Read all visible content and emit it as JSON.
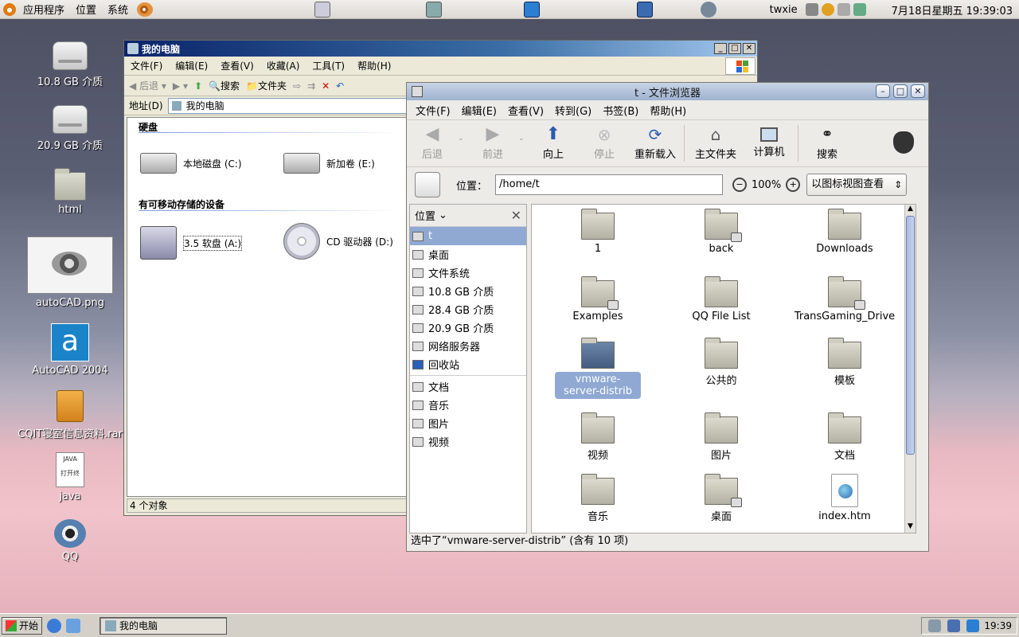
{
  "topbar": {
    "menu": [
      "应用程序",
      "位置",
      "系统"
    ],
    "user": "twxie",
    "datetime": "7月18日星期五 19:39:03"
  },
  "desktop_icons": [
    {
      "label": "10.8 GB 介质",
      "icon": "drive-icon"
    },
    {
      "label": "20.9 GB 介质",
      "icon": "drive-icon"
    },
    {
      "label": "html",
      "icon": "folder-icon"
    },
    {
      "label": "autoCAD.png",
      "icon": "image-thumbnail-icon"
    },
    {
      "label": "AutoCAD 2004",
      "icon": "autocad-icon"
    },
    {
      "label": "CQIT寝室信息资料.rar",
      "icon": "archive-icon"
    },
    {
      "label": "java",
      "icon": "text-file-icon",
      "badge_text": [
        "JAVA",
        "打开终"
      ]
    },
    {
      "label": "QQ",
      "icon": "qq-icon"
    }
  ],
  "mycomputer": {
    "title": "我的电脑",
    "menu": [
      "文件(F)",
      "编辑(E)",
      "查看(V)",
      "收藏(A)",
      "工具(T)",
      "帮助(H)"
    ],
    "toolbar": {
      "back": "后退",
      "search": "搜索",
      "folders": "文件夹"
    },
    "address_label": "地址(D)",
    "address_value": "我的电脑",
    "section_hdd": "硬盘",
    "drives": [
      "本地磁盘 (C:)",
      "新加卷 (E:)"
    ],
    "section_removable": "有可移动存储的设备",
    "removable": [
      "3.5 软盘 (A:)",
      "CD 驱动器 (D:)"
    ],
    "status": "4 个对象"
  },
  "nautilus": {
    "title": "t - 文件浏览器",
    "menu": [
      "文件(F)",
      "编辑(E)",
      "查看(V)",
      "转到(G)",
      "书签(B)",
      "帮助(H)"
    ],
    "toolbar": {
      "back": "后退",
      "forward": "前进",
      "up": "向上",
      "stop": "停止",
      "reload": "重新载入",
      "home": "主文件夹",
      "computer": "计算机",
      "search": "搜索"
    },
    "location_label": "位置：",
    "location_path": "/home/t",
    "zoom": "100%",
    "view_mode": "以图标视图查看",
    "sidebar_title": "位置",
    "sidebar_places": [
      "t",
      "桌面",
      "文件系统",
      "10.8 GB 介质",
      "28.4 GB 介质",
      "20.9 GB 介质",
      "网络服务器",
      "回收站"
    ],
    "sidebar_bookmarks": [
      "文档",
      "音乐",
      "图片",
      "视频"
    ],
    "files": [
      {
        "name": "1",
        "badge": ""
      },
      {
        "name": "back",
        "badge": "lock"
      },
      {
        "name": "Downloads",
        "badge": ""
      },
      {
        "name": "Examples",
        "badge": "link-lock"
      },
      {
        "name": "QQ File List",
        "badge": ""
      },
      {
        "name": "TransGaming_Drive",
        "badge": "link"
      },
      {
        "name": "vmware-server-distrib",
        "badge": "",
        "selected": true
      },
      {
        "name": "公共的",
        "badge": ""
      },
      {
        "name": "模板",
        "badge": ""
      },
      {
        "name": "视频",
        "badge": ""
      },
      {
        "name": "图片",
        "badge": ""
      },
      {
        "name": "文档",
        "badge": ""
      },
      {
        "name": "音乐",
        "badge": ""
      },
      {
        "name": "桌面",
        "badge": "desktop"
      },
      {
        "name": "index.htm",
        "badge": "",
        "type": "html"
      }
    ],
    "status": "选中了“vmware-server-distrib” (含有  10 项)"
  },
  "taskbar": {
    "start": "开始",
    "task": "我的电脑",
    "clock": "19:39"
  }
}
